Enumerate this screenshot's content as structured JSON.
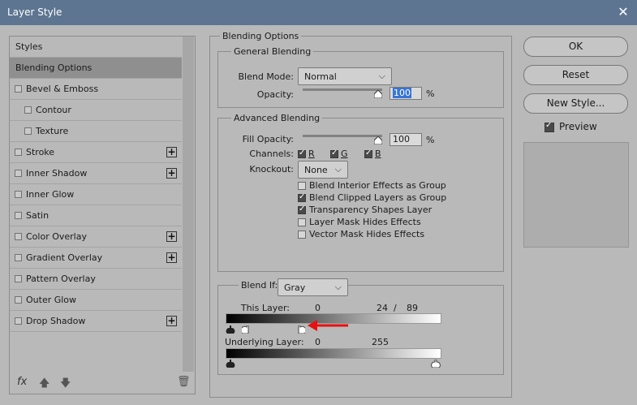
{
  "window": {
    "title": "Layer Style",
    "close_glyph": "✕"
  },
  "sidebar": {
    "items": [
      {
        "label": "Styles",
        "checkbox": false,
        "sub": false,
        "plus": false,
        "selected": false
      },
      {
        "label": "Blending Options",
        "checkbox": false,
        "sub": false,
        "plus": false,
        "selected": true
      },
      {
        "label": "Bevel & Emboss",
        "checkbox": true,
        "sub": false,
        "plus": false,
        "selected": false
      },
      {
        "label": "Contour",
        "checkbox": true,
        "sub": true,
        "plus": false,
        "selected": false
      },
      {
        "label": "Texture",
        "checkbox": true,
        "sub": true,
        "plus": false,
        "selected": false
      },
      {
        "label": "Stroke",
        "checkbox": true,
        "sub": false,
        "plus": true,
        "selected": false
      },
      {
        "label": "Inner Shadow",
        "checkbox": true,
        "sub": false,
        "plus": true,
        "selected": false
      },
      {
        "label": "Inner Glow",
        "checkbox": true,
        "sub": false,
        "plus": false,
        "selected": false
      },
      {
        "label": "Satin",
        "checkbox": true,
        "sub": false,
        "plus": false,
        "selected": false
      },
      {
        "label": "Color Overlay",
        "checkbox": true,
        "sub": false,
        "plus": true,
        "selected": false
      },
      {
        "label": "Gradient Overlay",
        "checkbox": true,
        "sub": false,
        "plus": true,
        "selected": false
      },
      {
        "label": "Pattern Overlay",
        "checkbox": true,
        "sub": false,
        "plus": false,
        "selected": false
      },
      {
        "label": "Outer Glow",
        "checkbox": true,
        "sub": false,
        "plus": false,
        "selected": false
      },
      {
        "label": "Drop Shadow",
        "checkbox": true,
        "sub": false,
        "plus": true,
        "selected": false
      }
    ],
    "plus_glyph": "+",
    "footer": {
      "fx": "fx",
      "up": "🡅",
      "down": "🡇",
      "trash": "🗑"
    }
  },
  "blending_options": {
    "title": "Blending Options",
    "general": {
      "title": "General Blending",
      "blend_mode_label": "Blend Mode:",
      "blend_mode_value": "Normal",
      "opacity_label": "Opacity:",
      "opacity_value": "100",
      "percent": "%"
    },
    "advanced": {
      "title": "Advanced Blending",
      "fill_opacity_label": "Fill Opacity:",
      "fill_opacity_value": "100",
      "percent": "%",
      "channels_label": "Channels:",
      "channels": [
        {
          "label": "R",
          "checked": true
        },
        {
          "label": "G",
          "checked": true
        },
        {
          "label": "B",
          "checked": true
        }
      ],
      "knockout_label": "Knockout:",
      "knockout_value": "None",
      "options": [
        {
          "label": "Blend Interior Effects as Group",
          "checked": false
        },
        {
          "label": "Blend Clipped Layers as Group",
          "checked": true
        },
        {
          "label": "Transparency Shapes Layer",
          "checked": true
        },
        {
          "label": "Layer Mask Hides Effects",
          "checked": false
        },
        {
          "label": "Vector Mask Hides Effects",
          "checked": false
        }
      ]
    },
    "blend_if": {
      "label": "Blend If:",
      "value": "Gray",
      "this_layer_label": "This Layer:",
      "this_layer_low": "0",
      "this_layer_high_a": "24",
      "separator": "/",
      "this_layer_high_b": "89",
      "underlying_label": "Underlying Layer:",
      "underlying_low": "0",
      "underlying_high": "255"
    }
  },
  "buttons": {
    "ok": "OK",
    "reset": "Reset",
    "new_style": "New Style...",
    "preview": "Preview",
    "preview_checked": true
  },
  "colors": {
    "titlebar": "#5d7590",
    "annotation_arrow": "#e81010",
    "selection": "#3875d6"
  }
}
